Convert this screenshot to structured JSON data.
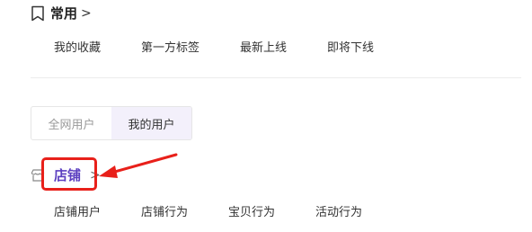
{
  "common": {
    "title": "常用",
    "chevron": ">",
    "links": [
      "我的收藏",
      "第一方标签",
      "最新上线",
      "即将下线"
    ]
  },
  "toggle": {
    "options": [
      "全网用户",
      "我的用户"
    ],
    "selected": "我的用户"
  },
  "store": {
    "title": "店铺",
    "chevron": ">",
    "links": [
      "店铺用户",
      "店铺行为",
      "宝贝行为",
      "活动行为"
    ]
  },
  "colors": {
    "accent": "#5b3fc0",
    "annotation": "#e8201a",
    "toggle_active_bg": "#f3f0fb"
  },
  "icons": {
    "common": "bookmark-icon",
    "store": "store-icon",
    "annotation": "arrow-annotation"
  }
}
